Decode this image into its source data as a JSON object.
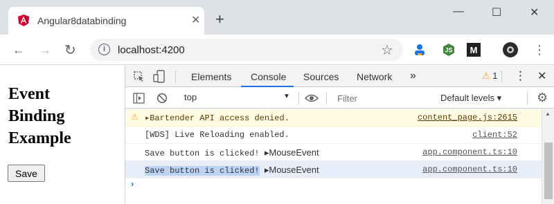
{
  "browser": {
    "tab_title": "Angular8databinding",
    "tab_close": "✕",
    "new_tab": "+",
    "minimize": "—",
    "maximize": "☐",
    "close": "✕",
    "url": "localhost:4200",
    "back": "←",
    "forward": "→",
    "reload": "↻",
    "menu": "⋮",
    "extensions": [
      "person-icon",
      "node-icon",
      "medium-icon",
      "avatar"
    ]
  },
  "page": {
    "heading_lines": [
      "Event",
      "Binding",
      "Example"
    ],
    "save_label": "Save"
  },
  "devtools": {
    "tabs": [
      "Elements",
      "Console",
      "Sources",
      "Network"
    ],
    "more_tabs": "»",
    "active_tab": "Console",
    "warning_count": "1",
    "context": "top",
    "filter_placeholder": "Filter",
    "levels_label": "Default levels ▾",
    "messages": [
      {
        "text": "▸Bartender API access denied.",
        "source": "content_page.js:2615",
        "type": "warning"
      },
      {
        "text": "[WDS] Live Reloading enabled.",
        "source": "client:52",
        "type": "log"
      },
      {
        "text": "Save button is clicked!",
        "extra": "▸MouseEvent",
        "source": "app.component.ts:10",
        "type": "log"
      },
      {
        "text": "Save button is clicked!",
        "extra": "▸MouseEvent",
        "source": "app.component.ts:10",
        "type": "log",
        "selected": true
      }
    ],
    "prompt": "›"
  },
  "colors": {
    "tabstrip": "#dee1e6",
    "accent": "#1a73e8",
    "warning_bg": "#fffbe5",
    "angular": "#dd0031"
  }
}
